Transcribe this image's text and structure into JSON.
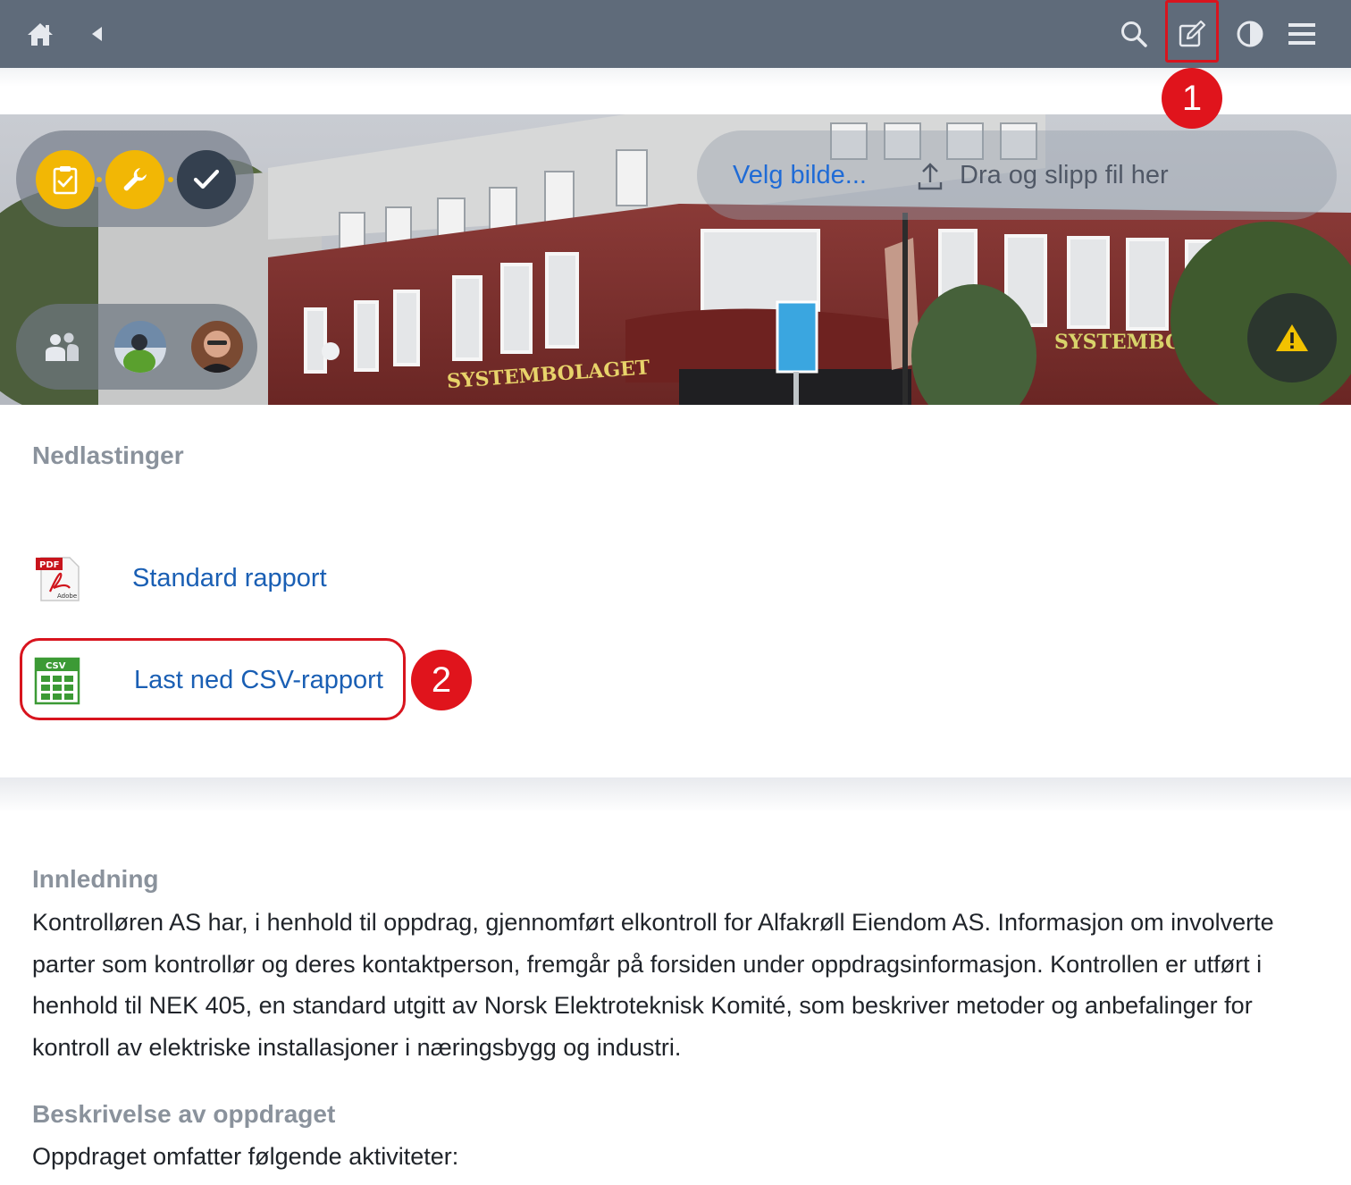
{
  "topbar": {
    "home_icon": "home-icon",
    "back_icon": "back-arrow-icon",
    "search_icon": "search-icon",
    "edit_icon": "edit-note-icon",
    "contrast_icon": "contrast-icon",
    "menu_icon": "hamburger-menu-icon",
    "background": "#5f6b7a"
  },
  "annotations": {
    "badge_1": "1",
    "badge_2": "2",
    "highlight_color": "#d8141e"
  },
  "hero": {
    "status_icons": [
      "clipboard-check-icon",
      "wrench-icon",
      "checkmark-icon"
    ],
    "upload": {
      "choose_label": "Velg bilde...",
      "drop_label": "Dra og slipp fil her"
    },
    "people_icon": "people-icon",
    "warning_icon": "warning-icon",
    "sign_text_1": "SYSTEMBOLAGET",
    "sign_text_2": "SYSTEMBOLAGET"
  },
  "downloads": {
    "title": "Nedlastinger",
    "items": [
      {
        "label": "Standard rapport",
        "icon": "pdf-file-icon",
        "icon_text": "PDF",
        "icon_subtext": "Adobe"
      },
      {
        "label": "Last ned CSV-rapport",
        "icon": "csv-file-icon",
        "icon_text": "CSV"
      }
    ]
  },
  "sections": [
    {
      "title": "Innledning",
      "body": "Kontrolløren AS har, i henhold til oppdrag, gjennomført elkontroll for Alfakrøll Eiendom AS. Informasjon om involverte parter som kontrollør og deres kontaktperson, fremgår på forsiden under oppdragsinformasjon. Kontrollen er utført i henhold til NEK 405, en standard utgitt av Norsk Elektroteknisk Komité, som beskriver metoder og anbefalinger for kontroll av elektriske installasjoner i næringsbygg og industri."
    },
    {
      "title": "Beskrivelse av oppdraget",
      "body": "Oppdraget omfatter følgende aktiviteter:"
    }
  ]
}
